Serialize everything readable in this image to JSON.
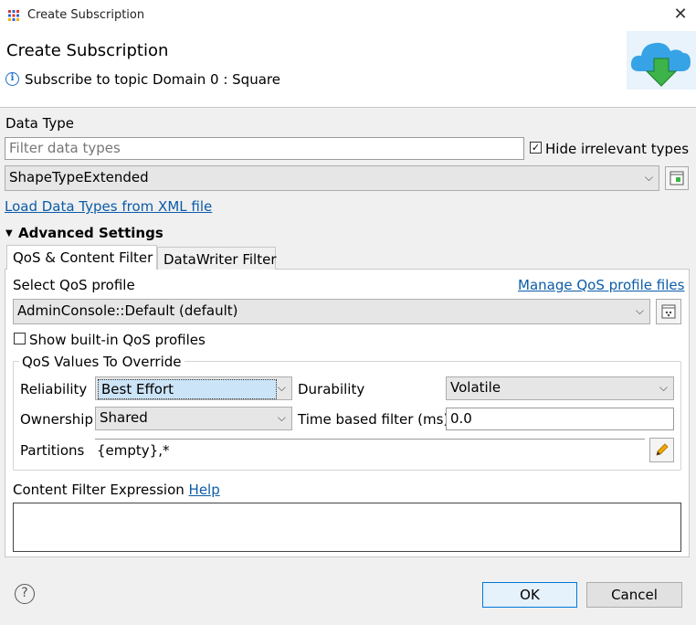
{
  "window": {
    "title": "Create Subscription"
  },
  "header": {
    "title": "Create Subscription",
    "subtitle": "Subscribe to topic Domain 0 : Square"
  },
  "data_type": {
    "section_label": "Data Type",
    "filter_placeholder": "Filter data types",
    "hide_irrelevant_label": "Hide irrelevant types",
    "hide_irrelevant_checked": true,
    "selected_type": "ShapeTypeExtended",
    "load_xml_link": "Load Data Types from XML file"
  },
  "advanced": {
    "label": "Advanced Settings",
    "tabs": [
      {
        "label": "QoS & Content Filter",
        "active": true
      },
      {
        "label": "DataWriter Filter",
        "active": false
      }
    ]
  },
  "qos": {
    "profile_label": "Select QoS profile",
    "manage_link": "Manage QoS profile files",
    "selected_profile": "AdminConsole::Default (default)",
    "show_builtin_label": "Show built-in QoS profiles",
    "show_builtin_checked": false,
    "override_group_title": "QoS Values To Override",
    "reliability_label": "Reliability",
    "reliability_value": "Best Effort",
    "durability_label": "Durability",
    "durability_value": "Volatile",
    "ownership_label": "Ownership",
    "ownership_value": "Shared",
    "time_filter_label": "Time based filter (ms)",
    "time_filter_value": "0.0",
    "partitions_label": "Partitions",
    "partitions_value": "{empty},*"
  },
  "content_filter": {
    "label": "Content Filter Expression",
    "help_link": "Help",
    "expression": ""
  },
  "footer": {
    "help_icon_glyph": "?",
    "ok_label": "OK",
    "cancel_label": "Cancel"
  },
  "colors": {
    "link": "#0b5ca8",
    "default_button_border": "#0078d7",
    "cloud_blue": "#36a3e6",
    "arrow_green": "#3cb44a"
  },
  "icons": {
    "app": "app-grid-icon",
    "info": "info-icon",
    "banner": "cloud-download-icon",
    "browse_type": "browse-type-icon",
    "browse_profile": "browse-profile-icon",
    "edit_partitions": "pencil-icon",
    "help": "help-icon"
  }
}
